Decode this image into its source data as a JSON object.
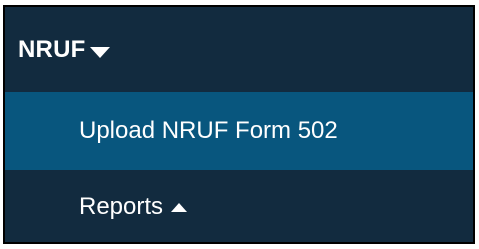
{
  "menu": {
    "header_label": "NRUF",
    "header_caret": "caret-down-icon",
    "items": [
      {
        "label": "Upload NRUF Form 502",
        "active": true
      },
      {
        "label": "Reports",
        "icon": "caret-up-icon"
      }
    ]
  },
  "colors": {
    "panel_bg": "#122b3f",
    "active_bg": "#08567e",
    "text": "#ffffff"
  }
}
